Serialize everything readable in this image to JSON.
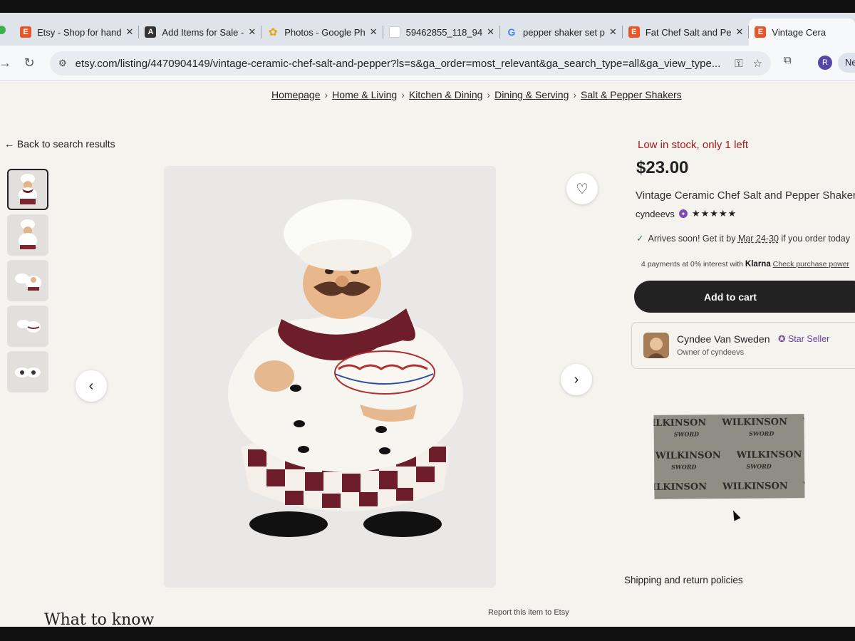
{
  "browser": {
    "tabs": [
      {
        "title": "Etsy - Shop for hand",
        "icon": "etsy-icon",
        "icon_letter": "E",
        "icon_color": "#e8562a"
      },
      {
        "title": "Add Items for Sale -",
        "icon": "app-icon",
        "icon_letter": "A",
        "icon_color": "#333333"
      },
      {
        "title": "Photos - Google Ph",
        "icon": "google-photos-icon",
        "icon_letter": "✿",
        "icon_color": "#f4b400"
      },
      {
        "title": "59462855_118_94",
        "icon": "image-icon",
        "icon_letter": "",
        "icon_color": "#ffffff"
      },
      {
        "title": "pepper shaker set p",
        "icon": "google-icon",
        "icon_letter": "G",
        "icon_color": "#4285f4"
      },
      {
        "title": "Fat Chef Salt and Pe",
        "icon": "etsy-icon",
        "icon_letter": "E",
        "icon_color": "#e8562a"
      },
      {
        "title": "Vintage Cera",
        "icon": "etsy-icon",
        "icon_letter": "E",
        "icon_color": "#e8562a"
      }
    ],
    "url": "etsy.com/listing/4470904149/vintage-ceramic-chef-salt-and-pepper?ls=s&ga_order=most_relevant&ga_search_type=all&ga_view_type...",
    "profile_initial": "R",
    "new_label": "Ne"
  },
  "breadcrumb": [
    "Homepage",
    "Home & Living",
    "Kitchen & Dining",
    "Dining & Serving",
    "Salt & Pepper Shakers"
  ],
  "back_link": "← Back to search results",
  "listing": {
    "stock_note": "Low in stock, only 1 left",
    "price": "$23.00",
    "title": "Vintage Ceramic Chef Salt and Pepper Shakers, I",
    "shop_name": "cyndeevs",
    "rating_stars": "★★★★★",
    "rating": 5,
    "arrives_prefix": "Arrives soon! Get it by",
    "arrives_dates": "Mar 24-30",
    "arrives_suffix": "if you order today",
    "klarna_prefix": "4 payments at 0% interest with",
    "klarna_brand": "Klarna",
    "klarna_link": "Check purchase power",
    "add_to_cart": "Add to cart",
    "seller_name": "Cyndee Van Sweden",
    "star_seller": "Star Seller",
    "seller_sub": "Owner of cyndeevs",
    "shipping_label": "Shipping and return policies",
    "what_to_know": "What to know",
    "report": "Report this item to Etsy"
  },
  "tape": {
    "brand": "WILKINSON",
    "sub": "SWORD"
  },
  "colors": {
    "stock": "#a61a1a",
    "star_seller": "#6b3fa3",
    "cart_button": "#222222"
  }
}
